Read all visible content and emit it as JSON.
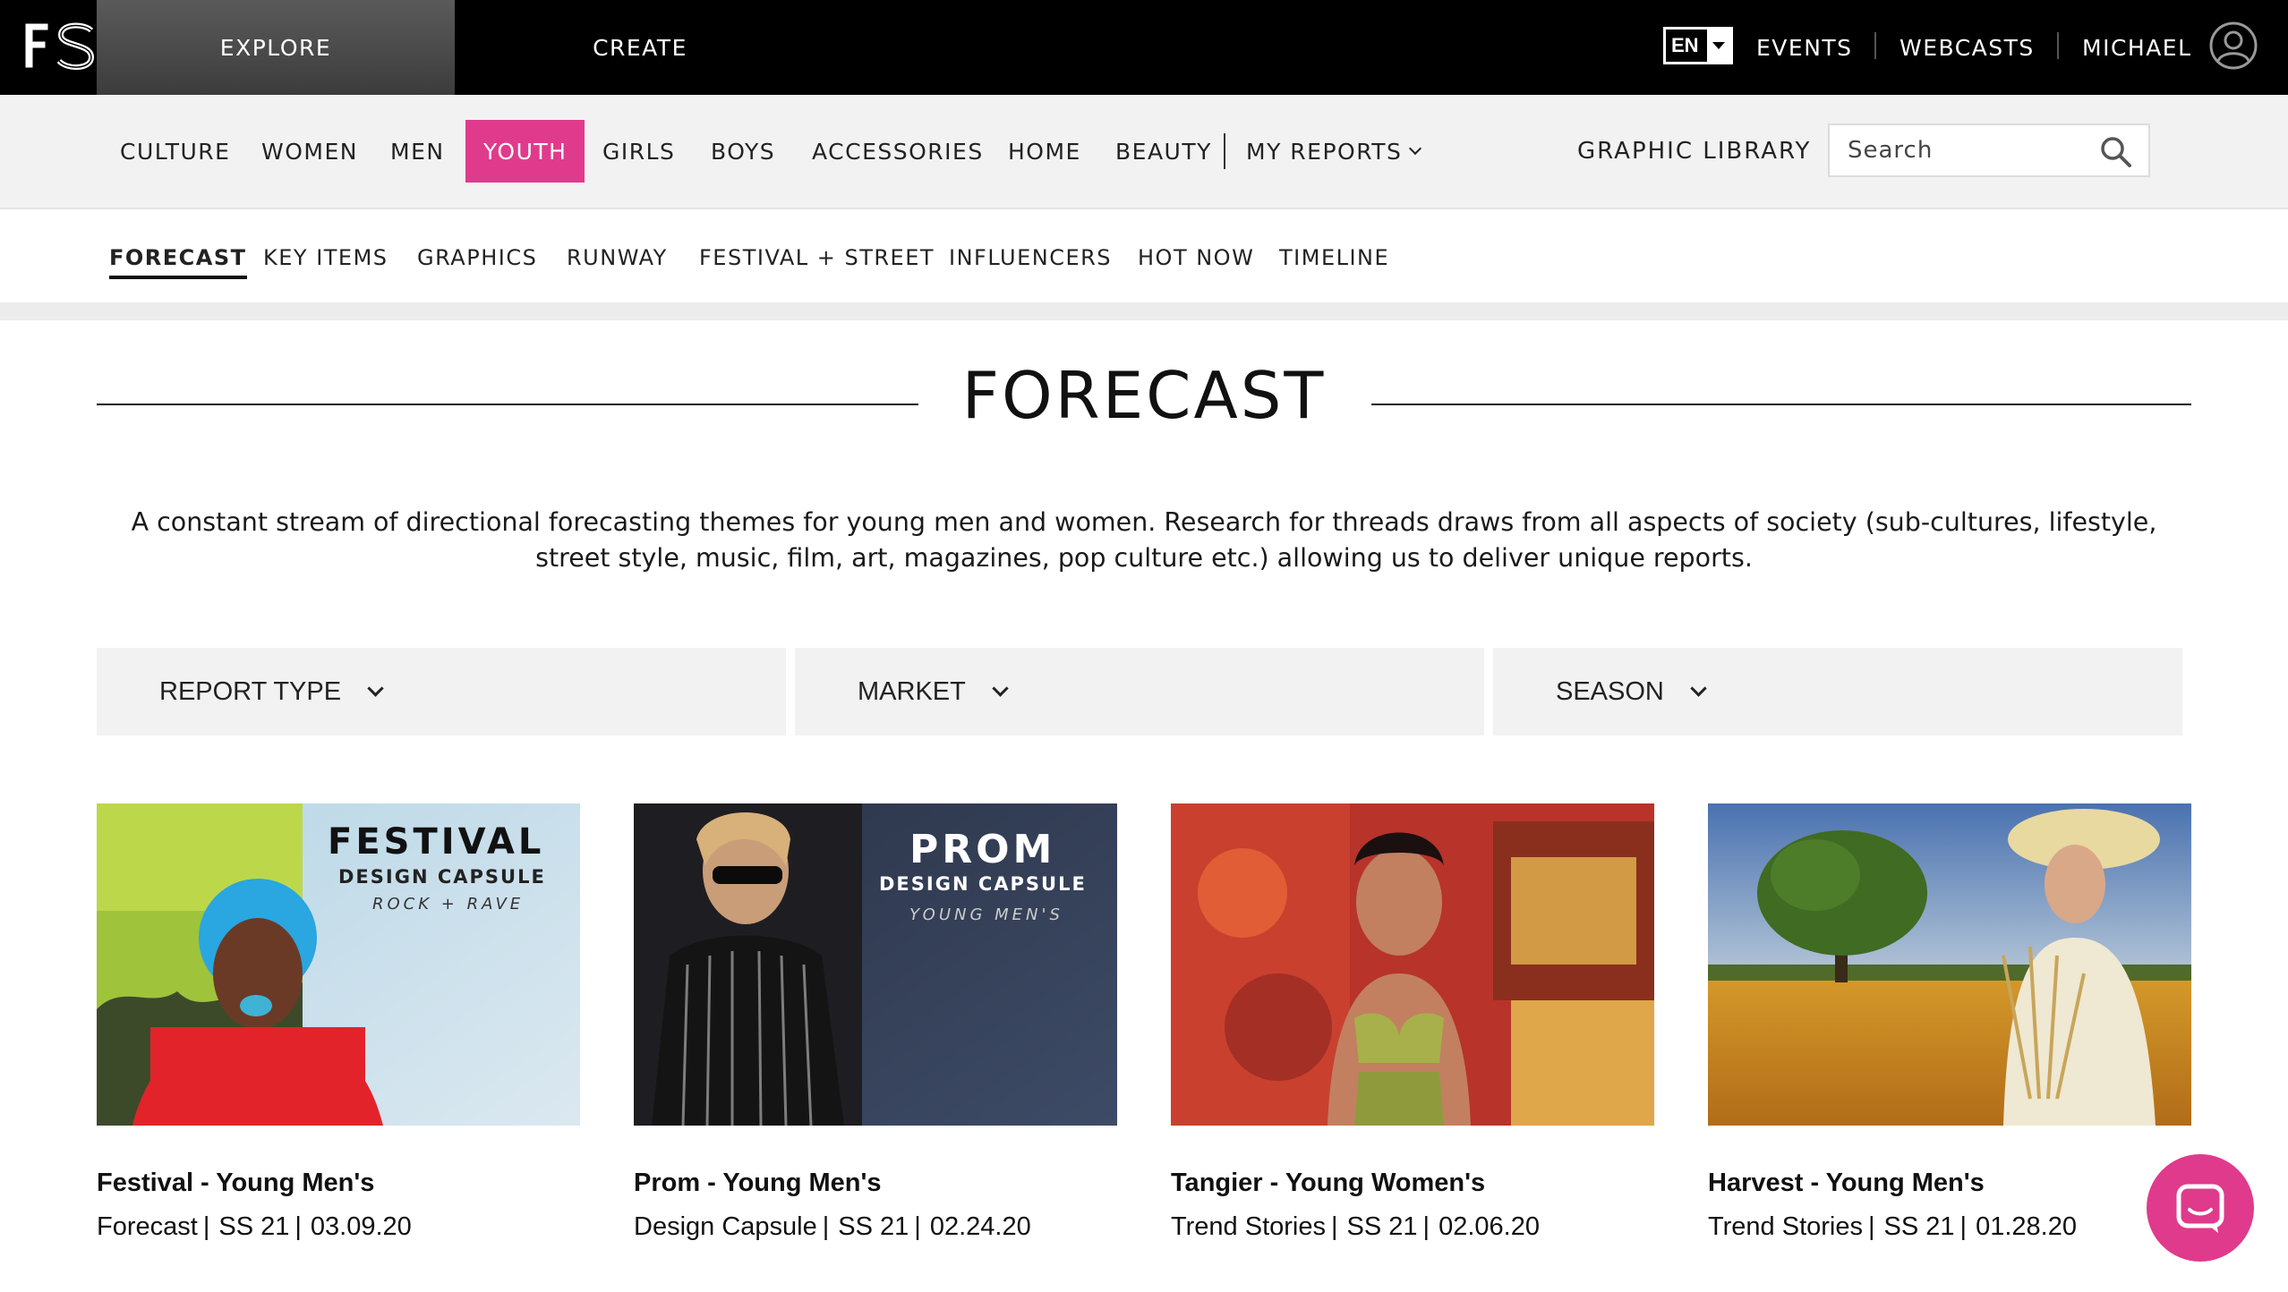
{
  "topbar": {
    "logo": "FS",
    "explore_label": "EXPLORE",
    "create_label": "CREATE",
    "language": "EN",
    "events_label": "EVENTS",
    "webcasts_label": "WEBCASTS",
    "user_label": "MICHAEL"
  },
  "categories": {
    "items": [
      "CULTURE",
      "WOMEN",
      "MEN",
      "YOUTH",
      "GIRLS",
      "BOYS",
      "ACCESSORIES",
      "HOME",
      "BEAUTY"
    ],
    "active": "YOUTH",
    "my_reports_label": "MY REPORTS",
    "graphic_library_label": "GRAPHIC LIBRARY",
    "search_placeholder": "Search"
  },
  "subnav": {
    "items": [
      "FORECAST",
      "KEY ITEMS",
      "GRAPHICS",
      "RUNWAY",
      "FESTIVAL + STREET",
      "INFLUENCERS",
      "HOT NOW",
      "TIMELINE"
    ],
    "active": "FORECAST"
  },
  "page": {
    "title": "FORECAST",
    "description": "A constant stream of directional forecasting themes for young men and women. Research for threads draws from all aspects of society (sub-cultures, lifestyle, street style, music, film, art, magazines, pop culture etc.) allowing us to deliver unique reports."
  },
  "filters": {
    "report_type": "REPORT TYPE",
    "market": "MARKET",
    "season": "SEASON"
  },
  "cards": [
    {
      "title": "Festival - Young Men's",
      "type": "Forecast",
      "season": "SS 21",
      "date": "03.09.20",
      "overlay": {
        "line1": "FESTIVAL",
        "line2": "DESIGN CAPSULE",
        "line3": "ROCK + RAVE"
      }
    },
    {
      "title": "Prom - Young Men's",
      "type": "Design Capsule",
      "season": "SS 21",
      "date": "02.24.20",
      "overlay": {
        "line1": "PROM",
        "line2": "DESIGN CAPSULE",
        "line3": "YOUNG MEN'S"
      }
    },
    {
      "title": "Tangier - Young Women's",
      "type": "Trend Stories",
      "season": "SS 21",
      "date": "02.06.20"
    },
    {
      "title": "Harvest - Young Men's",
      "type": "Trend Stories",
      "season": "SS 21",
      "date": "01.28.20"
    }
  ],
  "colors": {
    "accent": "#e03a8c",
    "topbar": "#000000",
    "nav_bg": "#f2f2f2"
  },
  "icons": [
    "search-icon",
    "user-icon",
    "chevron-down-icon",
    "chat-icon"
  ]
}
